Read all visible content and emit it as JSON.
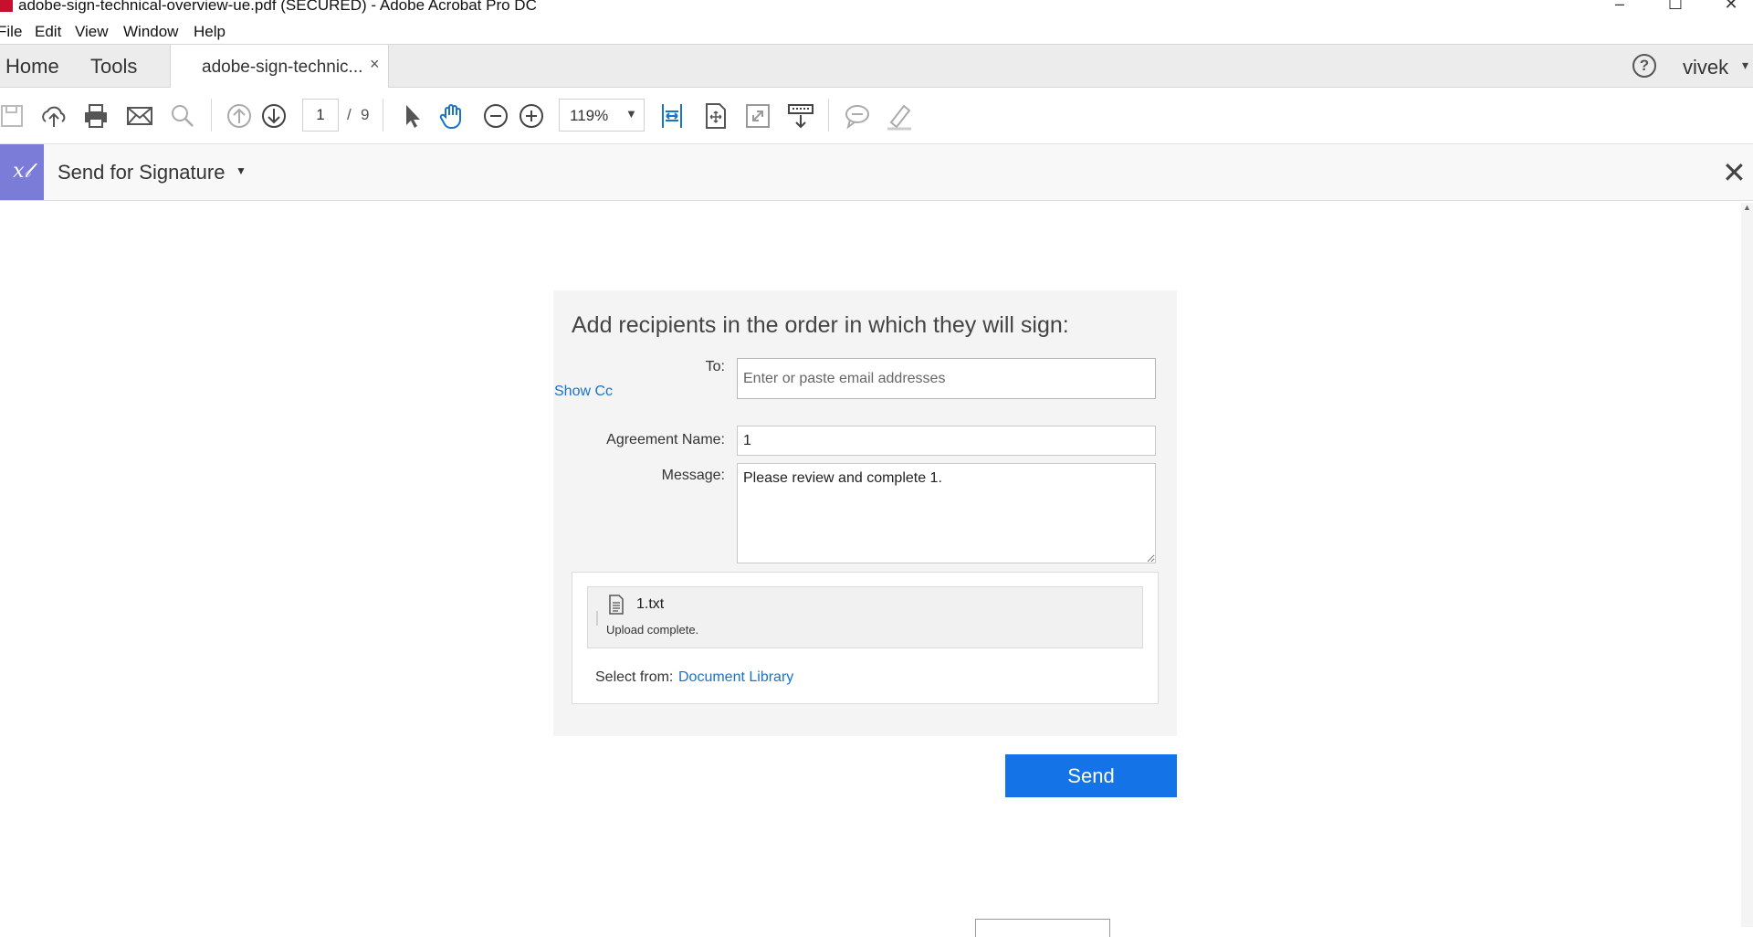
{
  "window": {
    "title": "adobe-sign-technical-overview-ue.pdf (SECURED) - Adobe Acrobat Pro DC",
    "minimize_glyph": "–",
    "maximize_glyph": "☐",
    "close_glyph": "✕"
  },
  "menu": {
    "items": [
      "File",
      "Edit",
      "View",
      "Window",
      "Help"
    ]
  },
  "tabs": {
    "home": "Home",
    "tools": "Tools",
    "document": "adobe-sign-technic...",
    "document_close": "×"
  },
  "account": {
    "help_glyph": "?",
    "user": "vivek"
  },
  "toolbar": {
    "page_current": "1",
    "page_separator": "/",
    "page_total": "9",
    "zoom": "119%",
    "icons": [
      "save-icon",
      "upload-cloud-icon",
      "print-icon",
      "email-icon",
      "search-icon",
      "previous-page-icon",
      "next-page-icon",
      "select-cursor-icon",
      "hand-tool-icon",
      "zoom-out-icon",
      "zoom-in-icon",
      "fit-width-icon",
      "fit-page-icon",
      "full-screen-icon",
      "read-mode-icon",
      "comment-icon",
      "highlight-pen-icon"
    ],
    "active_color": "#1a73c8"
  },
  "panel": {
    "title": "Send for Signature",
    "badge": "x𝓁",
    "close_glyph": "✕",
    "badge_color": "#7b7bd8"
  },
  "form": {
    "heading": "Add recipients in the order in which they will sign:",
    "to_label": "To:",
    "to_placeholder": "Enter or paste email addresses",
    "show_cc": "Show Cc",
    "agreement_label": "Agreement Name:",
    "agreement_value": "1",
    "message_label": "Message:",
    "message_value": "Please review and complete 1.",
    "attachment": {
      "file_name": "1.txt",
      "status": "Upload complete."
    },
    "select_from_label": "Select from:",
    "document_library": "Document Library",
    "send_label": "Send",
    "send_color": "#1473e6"
  }
}
